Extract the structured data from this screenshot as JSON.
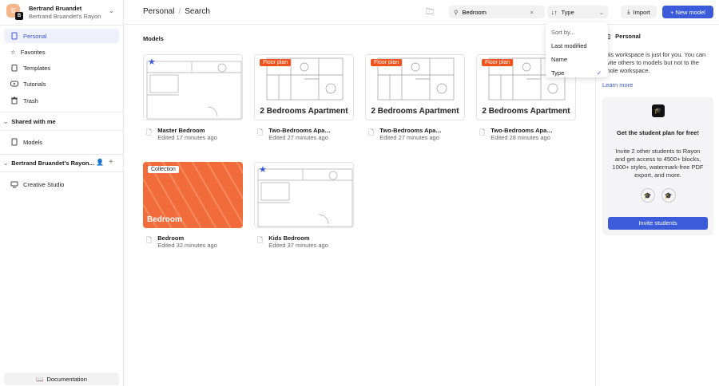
{
  "account": {
    "initial": "B",
    "badge": "B",
    "name": "Bertrand Bruandet",
    "workspace": "Bertrand Bruandet's Rayon"
  },
  "sidebar": {
    "items": [
      {
        "label": "Personal",
        "icon": "personal-icon"
      },
      {
        "label": "Favorites",
        "icon": "star-icon"
      },
      {
        "label": "Templates",
        "icon": "clipboard-icon"
      },
      {
        "label": "Tutorials",
        "icon": "play-icon"
      },
      {
        "label": "Trash",
        "icon": "trash-icon"
      }
    ],
    "shared_title": "Shared with me",
    "shared_items": [
      {
        "label": "Models"
      }
    ],
    "workspace_title": "Bertrand Bruandet's Rayon...",
    "workspace_items": [
      {
        "label": "Creative Studio"
      }
    ],
    "documentation": "Documentation"
  },
  "header": {
    "breadcrumb": [
      "Personal",
      "Search"
    ],
    "search_value": "Bedroom",
    "sort_label": "Type",
    "import": "Import",
    "new_model": "+ New model"
  },
  "sort_menu": {
    "hint": "Sort by...",
    "options": [
      "Last modified",
      "Name",
      "Type"
    ],
    "selected": "Type"
  },
  "main": {
    "section": "Models",
    "cards": [
      {
        "title": "Master Bedroom",
        "sub": "Edited 17 minutes ago",
        "starred": true
      },
      {
        "title": "Two-Bedrooms Apartment",
        "sub": "Edited 27 minutes ago",
        "tag": "Floor plan",
        "label": "2 Bedrooms Apartment"
      },
      {
        "title": "Two-Bedrooms Apartment",
        "sub": "Edited 27 minutes ago",
        "tag": "Floor plan",
        "label": "2 Bedrooms Apartment"
      },
      {
        "title": "Two-Bedrooms Apartment",
        "sub": "Edited 28 minutes ago",
        "tag": "Floor plan",
        "label": "2 Bedrooms Apartment"
      },
      {
        "title": "Bedroom",
        "sub": "Edited 32 minutes ago",
        "tag": "Collection",
        "label": "Bedroom"
      },
      {
        "title": "Kids Bedroom",
        "sub": "Edited 37 minutes ago",
        "starred": true
      }
    ]
  },
  "right": {
    "title": "Personal",
    "desc": "This workspace is just for you. You can invite others to models but not to the whole workspace.",
    "learn_more": "Learn more",
    "promo": {
      "title": "Get the student plan for free!",
      "text": "Invite 2 other students to Rayon and get access to 4500+ blocks, 1000+ styles, watermark-free PDF export, and more.",
      "button": "Invite students"
    }
  },
  "colors": {
    "accent": "#3b5bdb",
    "tag": "#f0521c"
  }
}
